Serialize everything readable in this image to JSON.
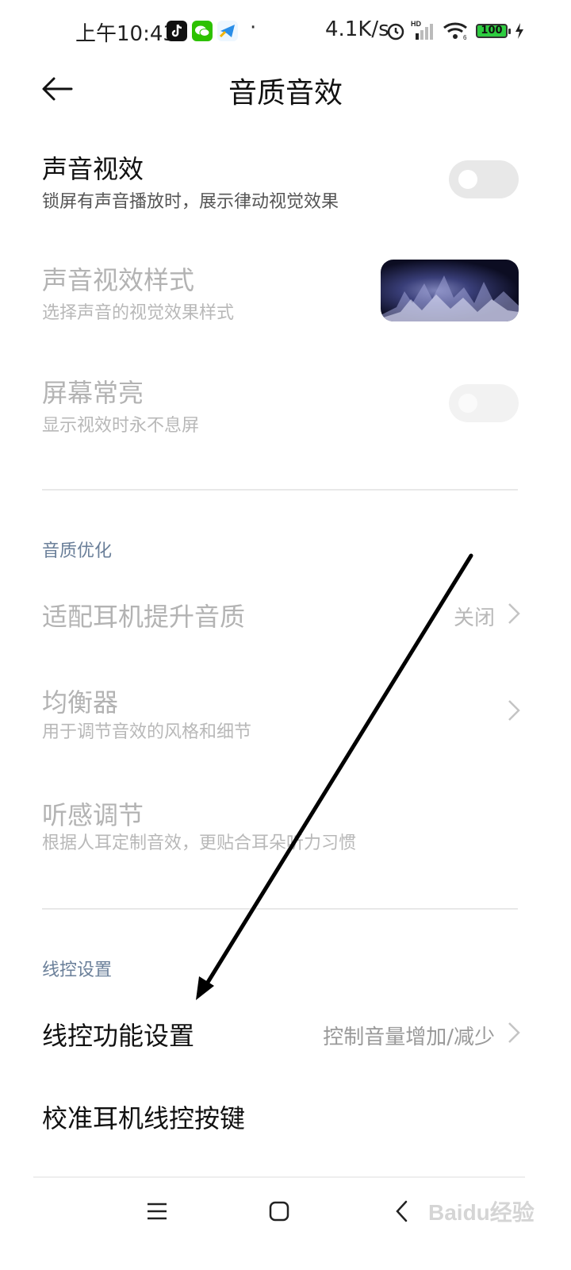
{
  "status_bar": {
    "time": "上午10:43",
    "separator": "·",
    "net_speed": "4.1K/s",
    "battery": "100",
    "icons": [
      "tiktok-icon",
      "wechat-icon",
      "telegram-icon",
      "alarm-icon",
      "signal-icon",
      "wifi-icon",
      "charging-icon"
    ]
  },
  "header": {
    "title": "音质音效",
    "back_icon": "arrow-left-icon"
  },
  "settings": {
    "sound_visual": {
      "title": "声音视效",
      "subtitle": "锁屏有声音播放时，展示律动视觉效果",
      "enabled": false
    },
    "sound_visual_style": {
      "title": "声音视效样式",
      "subtitle": "选择声音的视觉效果样式"
    },
    "screen_on": {
      "title": "屏幕常亮",
      "subtitle": "显示视效时永不息屏",
      "enabled": false
    }
  },
  "section_audio": {
    "header": "音质优化",
    "items": [
      {
        "title": "适配耳机提升音质",
        "value": "关闭"
      },
      {
        "title": "均衡器",
        "subtitle": "用于调节音效的风格和细节"
      },
      {
        "title": "听感调节",
        "subtitle": "根据人耳定制音效，更贴合耳朵听力习惯"
      }
    ]
  },
  "section_wire": {
    "header": "线控设置",
    "items": [
      {
        "title": "线控功能设置",
        "value": "控制音量增加/减少"
      },
      {
        "title": "校准耳机线控按键"
      }
    ]
  },
  "navbar": {
    "icons": [
      "menu-icon",
      "home-icon",
      "back-icon"
    ]
  },
  "watermark": "Baidu经验",
  "colors": {
    "accent_section": "#6a7f99",
    "disabled_text": "#b3b3b3",
    "battery_green": "#2ecc40"
  }
}
